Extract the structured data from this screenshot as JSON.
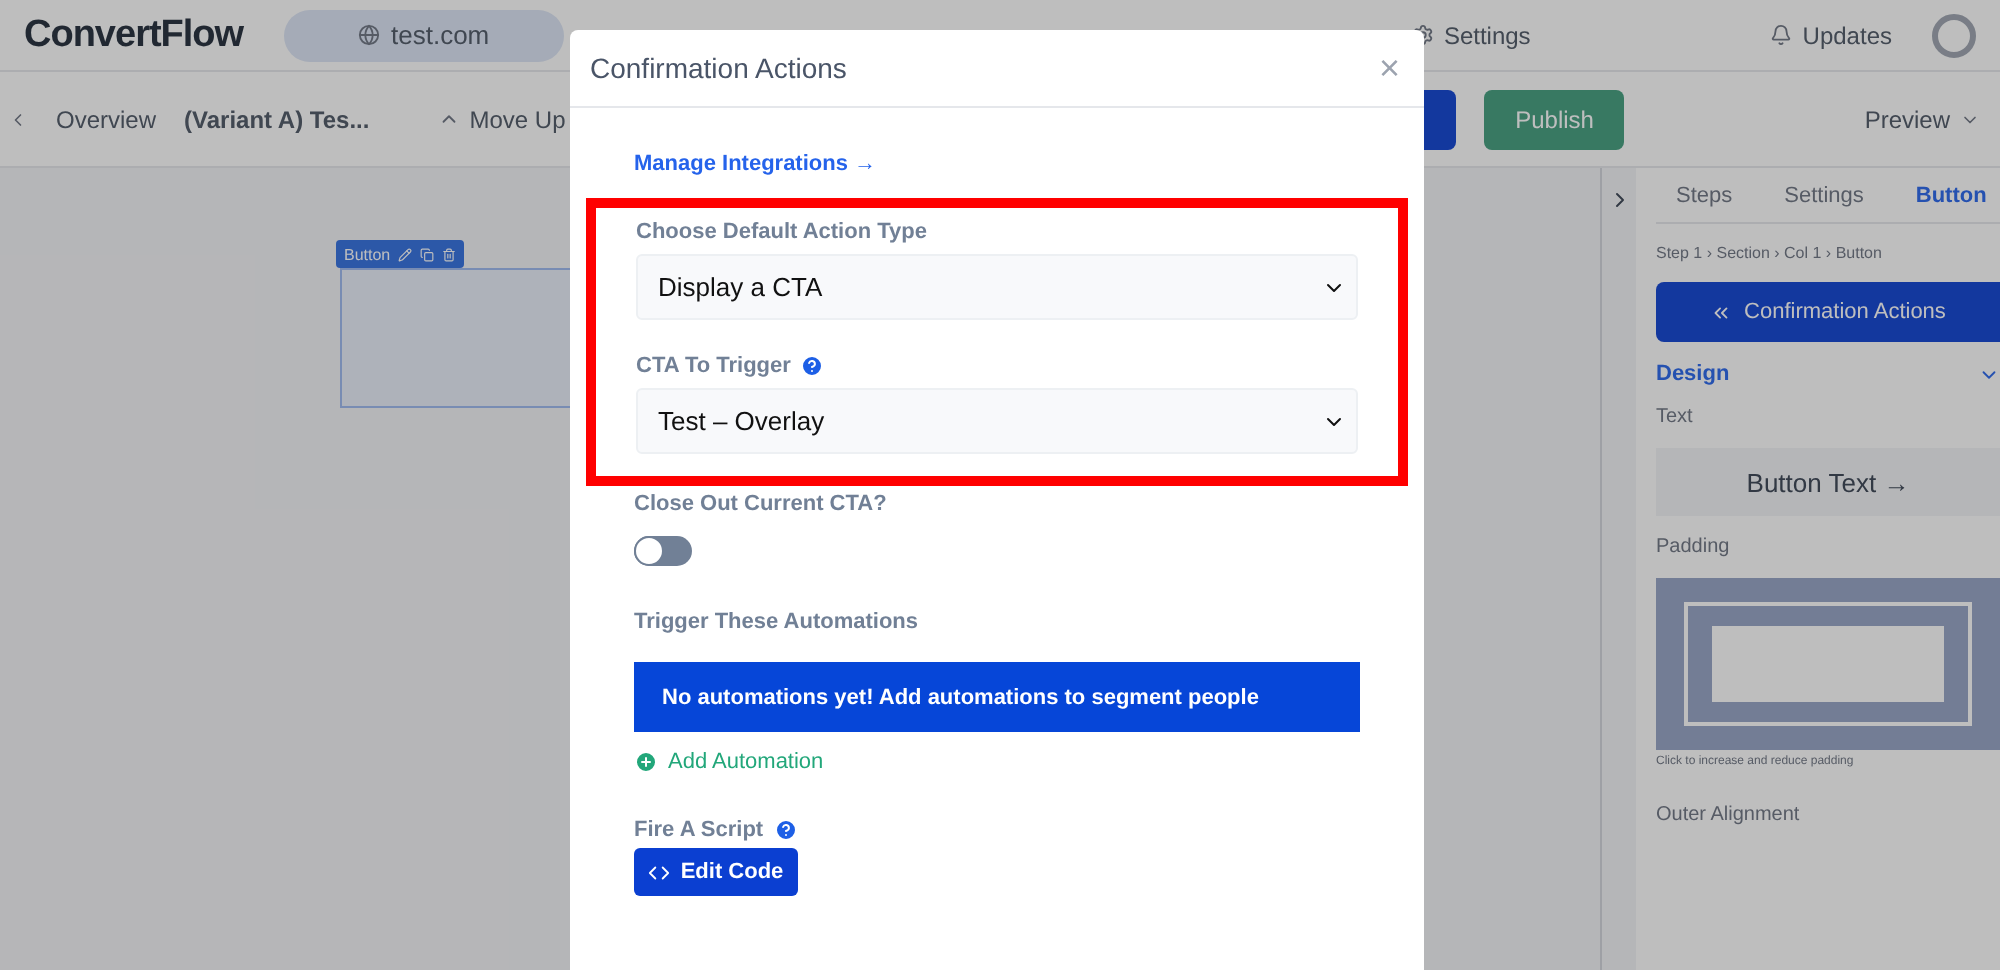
{
  "topbar": {
    "logo": "ConvertFlow",
    "site": "test.com",
    "nav": [
      {
        "label": "Settings"
      }
    ],
    "updates": "Updates"
  },
  "toolbar": {
    "breadcrumb": "Overview",
    "variant": "(Variant A) Tes...",
    "move_up": "Move Up",
    "publish": "Publish",
    "preview": "Preview"
  },
  "canvas": {
    "element_tag": "Button"
  },
  "sidebar": {
    "tabs": [
      {
        "label": "Steps",
        "selected": false
      },
      {
        "label": "Settings",
        "selected": false
      },
      {
        "label": "Button",
        "selected": true
      }
    ],
    "breadcrumb": "Step 1 › Section › Col 1 › Button",
    "action_button": "Confirmation Actions",
    "design": "Design",
    "text_label": "Text",
    "text_value": "Button Text →",
    "padding_label": "Padding",
    "padding_hint": "Click to increase and reduce padding",
    "alignment_label": "Outer Alignment"
  },
  "modal": {
    "title": "Confirmation Actions",
    "close": "×",
    "link": "Manage Integrations →",
    "highlight": true,
    "fields": [
      {
        "label": "Choose Default Action Type",
        "value": "Display a CTA",
        "help": false
      },
      {
        "label": "CTA To Trigger",
        "value": "Test – Overlay",
        "help": true
      }
    ],
    "toggle": {
      "label": "Close Out Current CTA?",
      "on": false
    },
    "automations": {
      "label": "Trigger These Automations",
      "notice": "No automations yet! Add automations to segment people",
      "add": "Add Automation"
    },
    "script": {
      "label": "Fire A Script",
      "button": "Edit Code"
    }
  }
}
